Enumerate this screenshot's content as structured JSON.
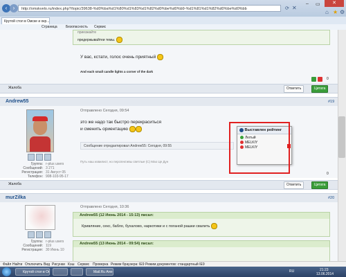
{
  "browser": {
    "address": "http://omskvelo.ru/index.php?/topic/39638-%d0%ba%d1%80%d1%83%d1%82%d0%be%d0%b9-%d1%81%d1%82%d0%be%d0%bb",
    "tab_title": "Крутой стол в Омске и окр...",
    "cmd": {
      "page": "Страница",
      "security": "Безопасность",
      "service": "Сервис"
    }
  },
  "post_top": {
    "quote_partial": "приезжайте",
    "quote_line": "предержывайтеи темы.",
    "text": "У вас, кстати, голос очень приятный",
    "signature": "And each small candle lights a corner of the dark",
    "rating_count": "0",
    "report": "Жалоба",
    "reply": "Ответить",
    "quote_btn": "Цитата"
  },
  "post_andrew": {
    "username": "Andrew55",
    "number": "#19",
    "sent": "Отправлено Сегодня, 09:54",
    "group_label": "Группа:",
    "group": "г-plus users",
    "msgs_label": "Сообщений:",
    "msgs": "3 271",
    "reg_label": "Регистрация:",
    "reg": "31 Август 05",
    "phone_label": "Телефон:",
    "phone": "908-103-95-17",
    "line1": "это же надо так быстро перекраситься",
    "line2": "и сменить ориентацию",
    "edited": "Сообщение отредактировал Andrew55: Сегодня, 09:55",
    "signature": "Путь наш извилист, но перспективы светлые (С) Мао Це Дун",
    "rating_count": "0",
    "report": "Жалоба",
    "reply": "Ответить",
    "quote_btn": "Цитата"
  },
  "rating_popup": {
    "title": "Выставлен рейтинг",
    "items": [
      {
        "name": "Лютый",
        "color": "#3aa23a"
      },
      {
        "name": "MELKIY",
        "color": "#e03030"
      },
      {
        "name": "MELKIY",
        "color": "#e03030"
      }
    ]
  },
  "post_murz": {
    "username": "murZilka",
    "number": "#20",
    "sent": "Отправлено Сегодня, 10:36",
    "group_label": "Группа:",
    "group": "г-plus users",
    "msgs_label": "Сообщений:",
    "msgs": "119",
    "reg_label": "Регистрация:",
    "reg": "30 Июнь 10",
    "quote1_header": "Andrew55 (12 Июнь 2014 - 15:13) писал:",
    "quote1_text": "Кривляние, секс, бабло, бухалово, наркотики и с поганой рашки свалить",
    "quote2_header": "Andrew55 (13 Июнь 2014 - 09:54) писал:"
  },
  "statusbar": {
    "items": [
      "Файл",
      "Найти",
      "Отключить",
      "Вид",
      "Рисунки",
      "Кэш",
      "Сервис",
      "Проверка",
      "Режим браузера: IE9",
      "Режим документов: стандартный IE9"
    ]
  },
  "taskbar": {
    "apps": [
      "Крутой стол в Омске...",
      "",
      "Mail.Ru Агент"
    ],
    "lang": "RU",
    "time": "21:23",
    "date": "13.06.2014"
  }
}
